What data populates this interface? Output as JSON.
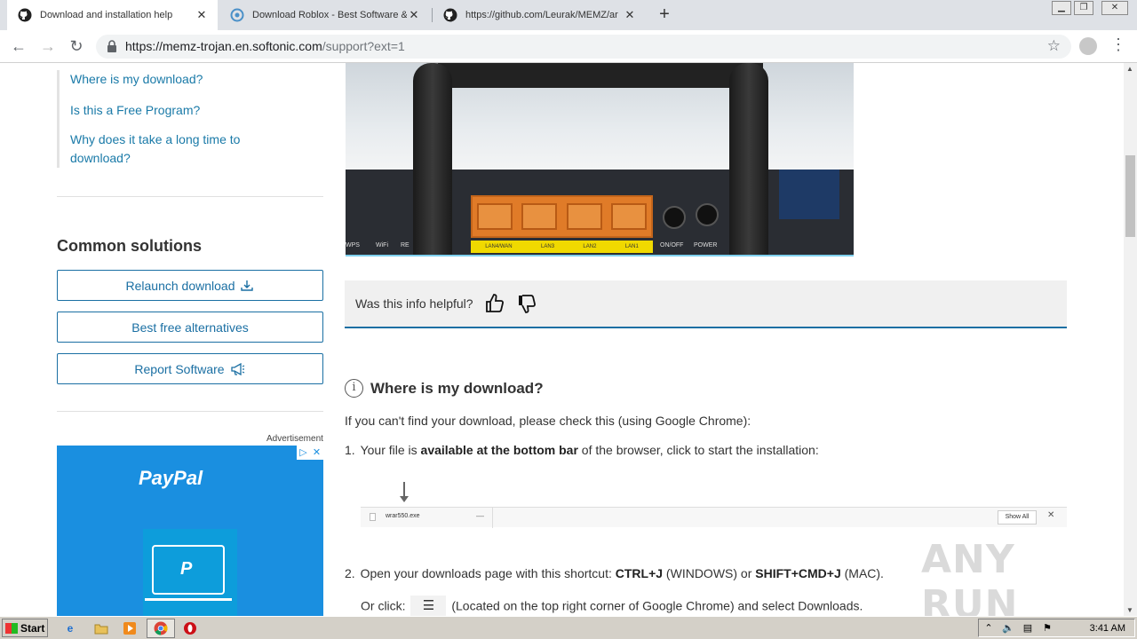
{
  "browser": {
    "tabs": [
      {
        "title": "Download and installation help",
        "favicon": "github-icon",
        "active": true
      },
      {
        "title": "Download Roblox - Best Software &",
        "favicon": "softonic-icon",
        "active": false
      },
      {
        "title": "https://github.com/Leurak/MEMZ/ar",
        "favicon": "github-icon",
        "active": false
      }
    ],
    "new_tab": "+",
    "url_main": "https://memz-trojan.en.softonic.com",
    "url_path": "/support?ext=1",
    "window_controls": [
      "minimize",
      "restore",
      "close"
    ]
  },
  "sidebar": {
    "faq_links": [
      {
        "label": "Where is my download?"
      },
      {
        "label": "Is this a Free Program?"
      },
      {
        "label": "Why does it take a long time to download?"
      }
    ],
    "common_title": "Common solutions",
    "buttons": [
      {
        "label": "Relaunch download",
        "icon": "download-icon"
      },
      {
        "label": "Best free alternatives"
      },
      {
        "label": "Report Software",
        "icon": "megaphone-icon"
      }
    ],
    "ad_label": "Advertisement",
    "ad": {
      "brand": "PayPal",
      "color": "#1a8fe0"
    }
  },
  "hero": {
    "port_labels": [
      "LAN4/WAN",
      "LAN3",
      "LAN2",
      "LAN1"
    ],
    "extra_labels": [
      "WPS",
      "WiFi",
      "RE",
      "ON/OFF",
      "POWER"
    ]
  },
  "feedback": {
    "question": "Was this info helpful?"
  },
  "section": {
    "title": "Where is my download?",
    "intro": "If you can't find your download, please check this (using Google Chrome):",
    "step1_num": "1.",
    "step1_a": "Your file is ",
    "step1_b": "available at the bottom bar",
    "step1_c": " of the browser, click to start the installation:",
    "screenshot": {
      "file": "wrar550.exe",
      "show_all": "Show All"
    },
    "step2_num": "2.",
    "step2_a": "Open your downloads page with this shortcut: ",
    "step2_k1": "CTRL+J",
    "step2_b": " (WINDOWS) or ",
    "step2_k2": "SHIFT+CMD+J",
    "step2_c": " (MAC).",
    "step2_click_a": "Or click:",
    "step2_click_b": "(Located on the top right corner of Google Chrome) and select Downloads."
  },
  "watermark": "ANY RUN",
  "taskbar": {
    "start": "Start",
    "clock": "3:41 AM"
  }
}
